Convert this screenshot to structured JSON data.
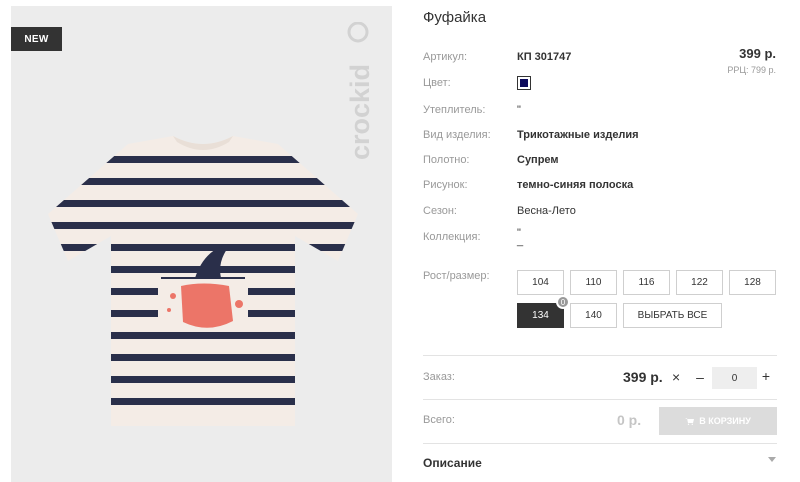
{
  "image": {
    "badge": "NEW",
    "brand": "crockid"
  },
  "product": {
    "title": "Фуфайка",
    "price": "399 р.",
    "rrp": "РРЦ: 799 р.",
    "color_hex": "#0d0b5c",
    "attributes": [
      {
        "label": "Артикул:",
        "value": "КП 301747"
      },
      {
        "label": "Цвет:",
        "value": ""
      },
      {
        "label": "Утеплитель:",
        "value": "\""
      },
      {
        "label": "Вид изделия:",
        "value": "Трикотажные изделия"
      },
      {
        "label": "Полотно:",
        "value": "Супрем"
      },
      {
        "label": "Рисунок:",
        "value": "темно-синяя полоска"
      },
      {
        "label": "Сезон:",
        "value": "Весна-Лето"
      },
      {
        "label": "Коллекция:",
        "value": "\""
      }
    ],
    "collection_extra": "_"
  },
  "sizes": {
    "label": "Рост/размер:",
    "items": [
      "104",
      "110",
      "116",
      "122",
      "128",
      "134",
      "140"
    ],
    "selected": "134",
    "selected_count": "0",
    "select_all": "ВЫБРАТЬ ВСЕ"
  },
  "order": {
    "label": "Заказ:",
    "price": "399 р.",
    "times": "×",
    "minus": "–",
    "qty": "0",
    "plus": "+"
  },
  "total": {
    "label": "Всего:",
    "value": "0 р.",
    "cart_label": "В КОРЗИНУ"
  },
  "description": {
    "label": "Описание"
  }
}
